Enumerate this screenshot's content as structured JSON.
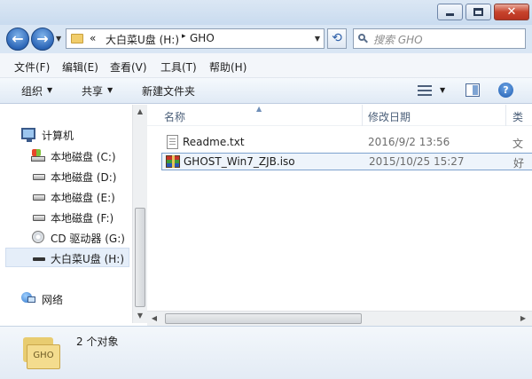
{
  "address": {
    "overflow_chevron": "«",
    "segments": [
      "大白菜U盘 (H:)",
      "GHO"
    ],
    "separator": "▸"
  },
  "search": {
    "placeholder": "搜索 GHO"
  },
  "menu": [
    "文件(F)",
    "编辑(E)",
    "查看(V)",
    "工具(T)",
    "帮助(H)"
  ],
  "toolbar": {
    "organize": "组织",
    "share": "共享",
    "new_folder": "新建文件夹"
  },
  "nav": {
    "computer": "计算机",
    "drives": [
      {
        "label": "本地磁盘 (C:)",
        "icon": "system-drive-icon"
      },
      {
        "label": "本地磁盘 (D:)",
        "icon": "drive-icon"
      },
      {
        "label": "本地磁盘 (E:)",
        "icon": "drive-icon"
      },
      {
        "label": "本地磁盘 (F:)",
        "icon": "drive-icon"
      },
      {
        "label": "CD 驱动器 (G:)",
        "icon": "cd-drive-icon"
      },
      {
        "label": "大白菜U盘 (H:)",
        "icon": "usb-drive-icon",
        "selected": true
      }
    ],
    "network": "网络"
  },
  "columns": {
    "name": "名称",
    "modified": "修改日期",
    "type_partial": "类"
  },
  "files": [
    {
      "name": "Readme.txt",
      "modified": "2016/9/2 13:56",
      "type_partial": "文",
      "icon": "text-file-icon"
    },
    {
      "name": "GHOST_Win7_ZJB.iso",
      "modified": "2015/10/25 15:27",
      "type_partial": "好",
      "icon": "archive-file-icon",
      "selected": true
    }
  ],
  "details": {
    "count": "2 个对象",
    "folder_label": "GHO"
  }
}
